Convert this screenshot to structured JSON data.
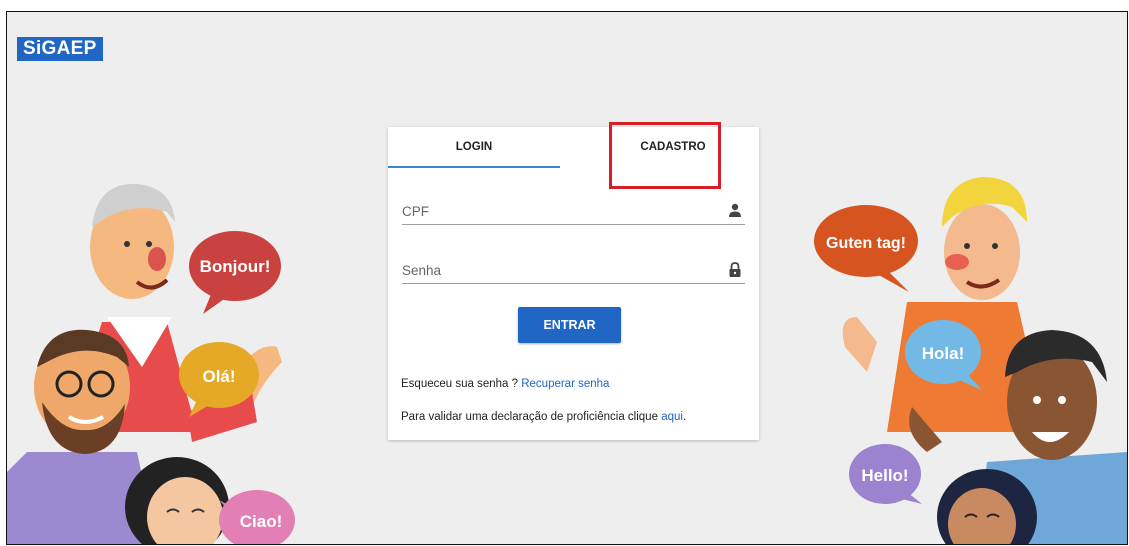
{
  "brand": {
    "logo_text": "SiGAEP"
  },
  "tabs": [
    {
      "label": "LOGIN",
      "active": true
    },
    {
      "label": "CADASTRO",
      "active": false
    }
  ],
  "form": {
    "cpf_placeholder": "CPF",
    "senha_placeholder": "Senha",
    "submit_label": "ENTRAR",
    "forgot_text": "Esqueceu sua senha ?",
    "forgot_link": "Recuperar senha",
    "validate_text": "Para validar uma declaração de proficiência clique",
    "validate_link": "aqui",
    "validate_suffix": "."
  },
  "bubbles": {
    "bonjour": "Bonjour!",
    "ola": "Olá!",
    "ciao": "Ciao!",
    "guten": "Guten tag!",
    "hola": "Hola!",
    "hello": "Hello!"
  },
  "colors": {
    "brand_blue": "#1f66c5",
    "highlight_red": "#d61f26",
    "background": "#eeeeee"
  },
  "icons": [
    "user-icon",
    "lock-icon",
    "up-arrow-annotation"
  ]
}
